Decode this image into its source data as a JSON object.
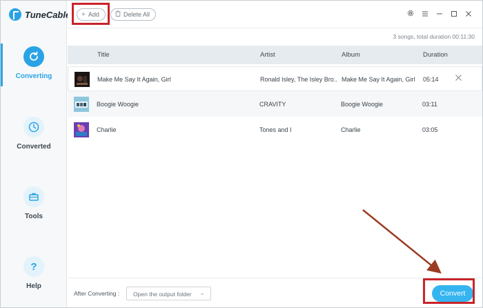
{
  "app": {
    "name": "TuneCable"
  },
  "sidebar": {
    "items": [
      {
        "label": "Converting",
        "icon": "refresh-icon",
        "active": true
      },
      {
        "label": "Converted",
        "icon": "clock-icon",
        "active": false
      },
      {
        "label": "Tools",
        "icon": "toolbox-icon",
        "active": false
      },
      {
        "label": "Help",
        "icon": "question-icon",
        "active": false
      }
    ]
  },
  "toolbar": {
    "add_label": "Add",
    "delete_all_label": "Delete All",
    "icons": [
      "gear-icon",
      "menu-icon",
      "minimize-icon",
      "maximize-icon",
      "close-icon"
    ]
  },
  "summary": "3 songs, total duration 00:11:30",
  "table": {
    "columns": [
      "Title",
      "Artist",
      "Album",
      "Duration"
    ],
    "rows": [
      {
        "title": "Make Me Say It Again, Girl",
        "artist": "Ronald Isley, The Isley Bro...",
        "album": "Make Me Say It Again, Girl",
        "duration": "05:14"
      },
      {
        "title": "Boogie Woogie",
        "artist": "CRAVITY",
        "album": "Boogie Woogie",
        "duration": "03:11"
      },
      {
        "title": "Charlie",
        "artist": "Tones and I",
        "album": "Charlie",
        "duration": "03:05"
      }
    ]
  },
  "bottom": {
    "after_converting_label": "After Converting :",
    "after_converting_value": "Open the output folder",
    "convert_label": "Convert"
  },
  "colors": {
    "accent": "#2aa3e6",
    "convert_button": "#35b5ef",
    "highlight": "#c8242a",
    "annotation_arrow": "#9b3b22"
  }
}
